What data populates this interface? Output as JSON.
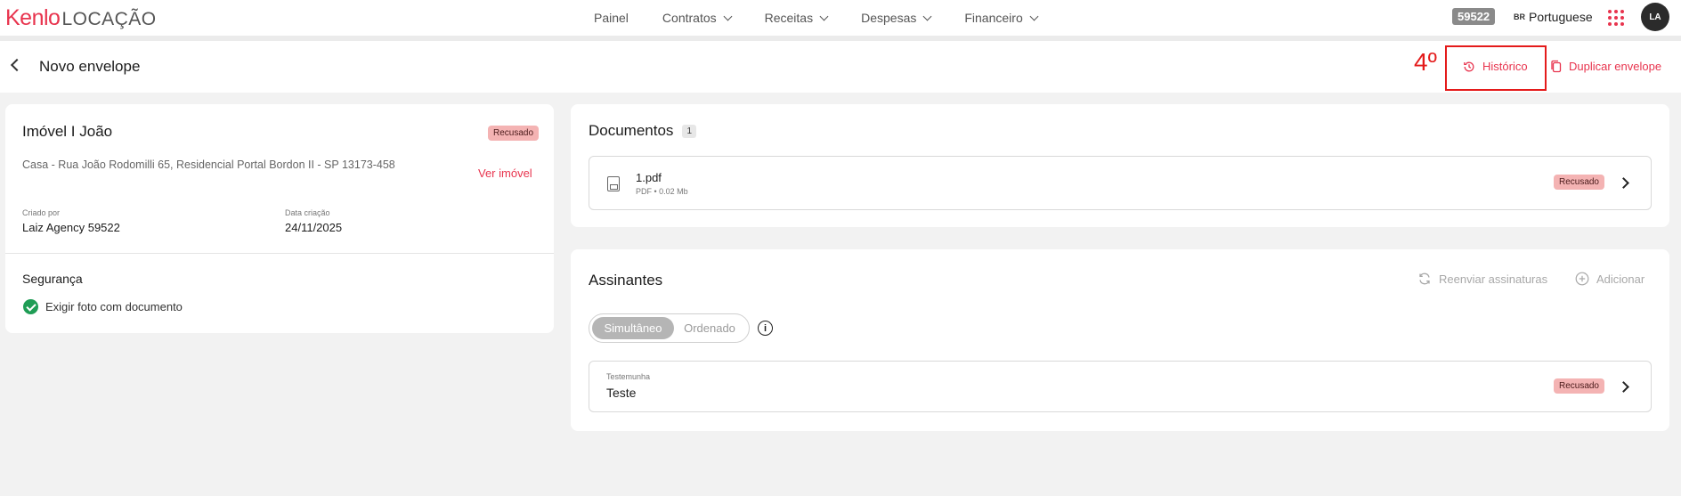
{
  "brand": {
    "name": "Kenlo",
    "product": "LOCAÇÃO",
    "accent": "#e8344e"
  },
  "nav": {
    "items": [
      {
        "label": "Painel",
        "dropdown": false
      },
      {
        "label": "Contratos",
        "dropdown": true
      },
      {
        "label": "Receitas",
        "dropdown": true
      },
      {
        "label": "Despesas",
        "dropdown": true
      },
      {
        "label": "Financeiro",
        "dropdown": true
      }
    ],
    "agency_code": "59522",
    "language": {
      "flag": "BR",
      "label": "Portuguese"
    },
    "avatar_initials": "LA"
  },
  "header": {
    "title": "Novo envelope",
    "step_annotation": "4º",
    "history_label": "Histórico",
    "duplicate_label": "Duplicar envelope"
  },
  "property": {
    "title": "Imóvel I João",
    "status": "Recusado",
    "address": "Casa - Rua João Rodomilli 65, Residencial Portal Bordon II - SP 13173-458",
    "view_link": "Ver imóvel",
    "created_by_label": "Criado por",
    "created_by": "Laiz Agency 59522",
    "created_date_label": "Data criação",
    "created_date": "24/11/2025",
    "security_title": "Segurança",
    "security_item": "Exigir foto com documento"
  },
  "documents": {
    "title": "Documentos",
    "count": "1",
    "items": [
      {
        "name": "1.pdf",
        "meta": "PDF • 0.02 Mb",
        "status": "Recusado"
      }
    ]
  },
  "signers": {
    "title": "Assinantes",
    "resend_label": "Reenviar assinaturas",
    "add_label": "Adicionar",
    "mode_options": [
      "Simultâneo",
      "Ordenado"
    ],
    "mode_selected": "Simultâneo",
    "info_glyph": "i",
    "items": [
      {
        "role": "Testemunha",
        "name": "Teste",
        "status": "Recusado"
      }
    ]
  }
}
